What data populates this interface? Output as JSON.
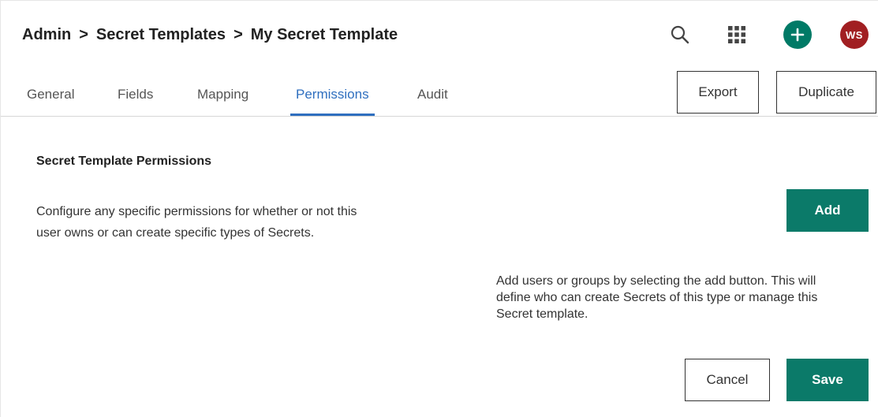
{
  "breadcrumb": {
    "items": [
      "Admin",
      "Secret Templates",
      "My Secret Template"
    ],
    "separator": ">"
  },
  "header_actions": {
    "search_icon": "search-icon",
    "apps_icon": "grid-icon",
    "add_icon": "plus-icon",
    "avatar_initials": "WS",
    "add_color": "#007a66",
    "avatar_color": "#a11f22"
  },
  "tabs": [
    {
      "label": "General",
      "active": false
    },
    {
      "label": "Fields",
      "active": false
    },
    {
      "label": "Mapping",
      "active": false
    },
    {
      "label": "Permissions",
      "active": true
    },
    {
      "label": "Audit",
      "active": false
    }
  ],
  "toolbar": {
    "export_label": "Export",
    "duplicate_label": "Duplicate"
  },
  "permissions": {
    "title": "Secret Template Permissions",
    "description": "Configure any specific permissions for whether or not this user owns or can create specific types of Secrets.",
    "add_label": "Add",
    "helper_text": "Add users or groups by selecting the add button. This will define who can create Secrets of this type or manage this Secret template."
  },
  "footer": {
    "cancel_label": "Cancel",
    "save_label": "Save"
  },
  "colors": {
    "accent": "#0b7a69",
    "active_tab": "#2f6fbf"
  }
}
